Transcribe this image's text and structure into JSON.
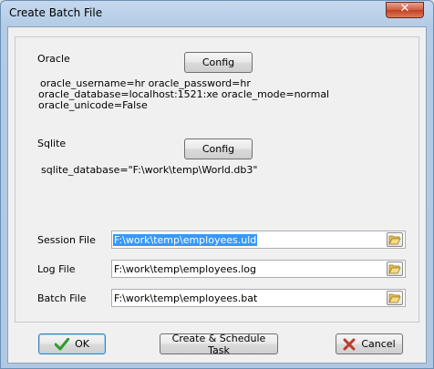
{
  "window": {
    "title": "Create Batch File",
    "close_glyph": "✕"
  },
  "oracle": {
    "heading": "Oracle",
    "config_label": "Config",
    "line1": "oracle_username=hr oracle_password=hr",
    "line2": "oracle_database=localhost:1521:xe oracle_mode=normal",
    "line3": "oracle_unicode=False"
  },
  "sqlite": {
    "heading": "Sqlite",
    "config_label": "Config",
    "line1": "sqlite_database=\"F:\\work\\temp\\World.db3\""
  },
  "files": [
    {
      "label": "Session File",
      "value": "F:\\work\\temp\\employees.uld",
      "selected": true
    },
    {
      "label": "Log File",
      "value": "F:\\work\\temp\\employees.log",
      "selected": false
    },
    {
      "label": "Batch File",
      "value": "F:\\work\\temp\\employees.bat",
      "selected": false
    }
  ],
  "buttons": {
    "ok": "OK",
    "schedule": "Create & Schedule Task",
    "cancel": "Cancel"
  },
  "icons": {
    "ok": "checkmark-icon",
    "cancel": "x-icon",
    "browse": "folder-open-icon",
    "close": "close-icon"
  },
  "colors": {
    "selection": "#3399ff",
    "ok_check": "#2e9a2e",
    "cancel_x": "#c0392b"
  }
}
